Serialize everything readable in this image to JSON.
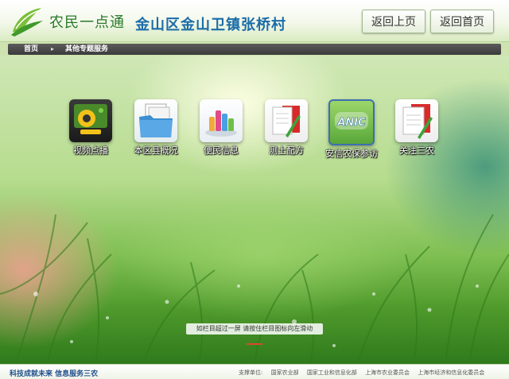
{
  "header": {
    "app_name": "农民一点通",
    "village": "金山区金山卫镇张桥村",
    "back_button": "返回上页",
    "home_button": "返回首页"
  },
  "breadcrumb": {
    "home": "首页",
    "separator": "▸",
    "current": "其他专题服务"
  },
  "tiles": [
    {
      "label": "视频点播",
      "icon": "webcam-icon"
    },
    {
      "label": "本区县概况",
      "icon": "folder-icon"
    },
    {
      "label": "便民信息",
      "icon": "bottles-icon"
    },
    {
      "label": "测土配方",
      "icon": "document-pen-icon"
    },
    {
      "label": "安信农保参访",
      "icon": "anic-logo-icon"
    },
    {
      "label": "关注三农",
      "icon": "notebook-pen-icon"
    }
  ],
  "hint": "如栏目超过一屏 请按住栏目图标向左滑动",
  "footer": {
    "slogan": "科技成就未来  信息服务三农",
    "supporters_label": "支撑单位:",
    "supporters": [
      "国家农业部",
      "国家工业和信息化部",
      "上海市农业委员会",
      "上海市经济和信息化委员会"
    ]
  },
  "colors": {
    "brand_green": "#2a7a2a",
    "title_blue": "#1b6ca8",
    "breadcrumb_bg": "#444444",
    "hint_accent": "#d94a2a"
  }
}
